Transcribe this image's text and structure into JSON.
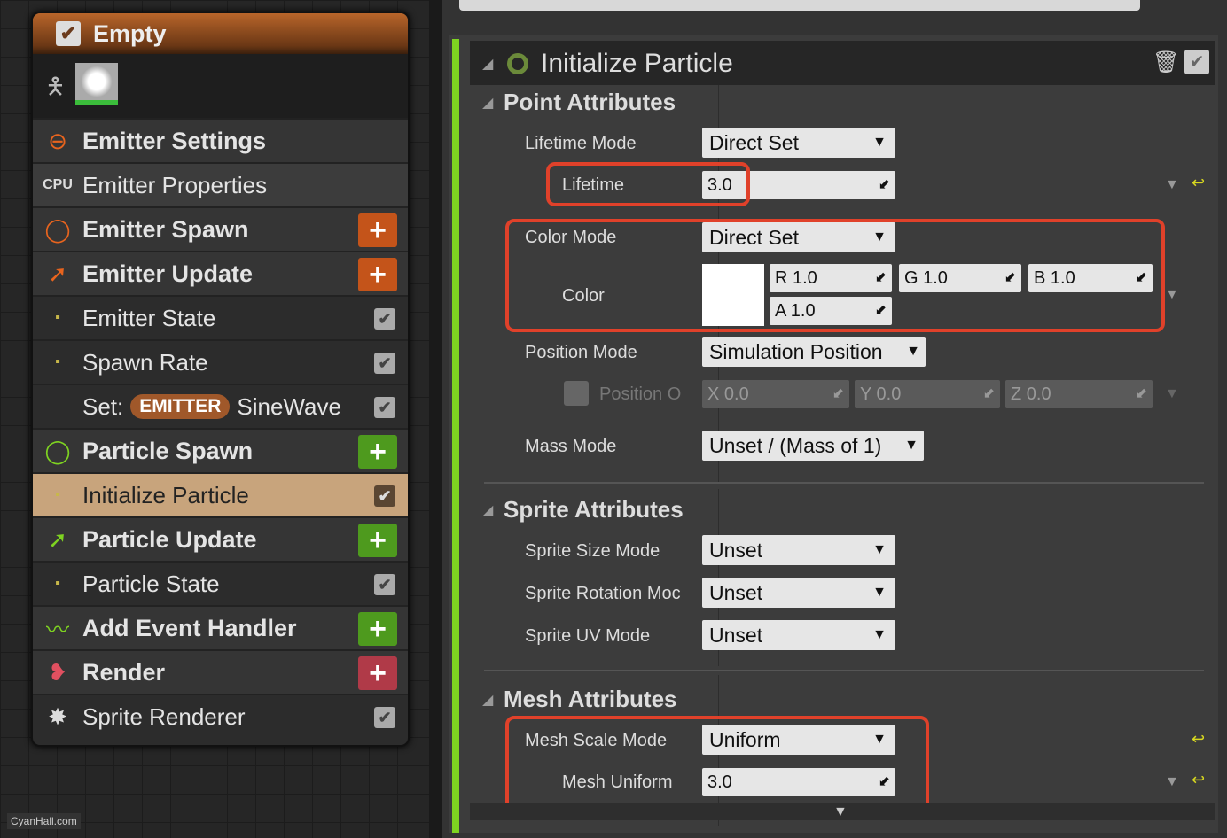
{
  "node": {
    "title": "Empty",
    "rows": [
      {
        "label": "Emitter Settings",
        "icon": "emitter-settings-icon",
        "type": "header"
      },
      {
        "label": "Emitter Properties",
        "icon": "cpu-icon",
        "type": "sub"
      },
      {
        "label": "Emitter Spawn",
        "icon": "ring-icon",
        "type": "header",
        "add": true,
        "color": "#c4541a"
      },
      {
        "label": "Emitter Update",
        "icon": "arrow-icon",
        "type": "header",
        "add": true,
        "color": "#c4541a"
      },
      {
        "label": "Emitter State",
        "icon": "module-icon",
        "type": "item",
        "checked": true
      },
      {
        "label": "Spawn Rate",
        "icon": "module-icon",
        "type": "item",
        "checked": true
      },
      {
        "label": "Set:",
        "pill": "EMITTER",
        "suffix": "SineWave",
        "type": "item",
        "checked": true
      },
      {
        "label": "Particle Spawn",
        "icon": "ring-icon",
        "type": "header",
        "add": true,
        "color": "#4e9a1e"
      },
      {
        "label": "Initialize Particle",
        "icon": "module-icon",
        "type": "selected",
        "checked": true
      },
      {
        "label": "Particle Update",
        "icon": "arrow-icon",
        "type": "header",
        "add": true,
        "color": "#4e9a1e"
      },
      {
        "label": "Particle State",
        "icon": "module-icon",
        "type": "item",
        "checked": true
      },
      {
        "label": "Add Event Handler",
        "icon": "event-icon",
        "type": "header",
        "add": true,
        "color": "#4e9a1e"
      },
      {
        "label": "Render",
        "icon": "render-icon",
        "type": "header",
        "add": true,
        "color": "#b03a48"
      },
      {
        "label": "Sprite Renderer",
        "icon": "sprite-icon",
        "type": "item",
        "checked": true
      }
    ]
  },
  "watermark": "CyanHall.com",
  "module": {
    "title": "Initialize Particle",
    "point": {
      "title": "Point Attributes",
      "lifetime_mode_label": "Lifetime Mode",
      "lifetime_mode": "Direct Set",
      "lifetime_label": "Lifetime",
      "lifetime": "3.0",
      "color_mode_label": "Color Mode",
      "color_mode": "Direct Set",
      "color_label": "Color",
      "color_hex": "#ffffff",
      "r": "R  1.0",
      "g": "G  1.0",
      "b": "B  1.0",
      "a": "A  1.0",
      "position_mode_label": "Position Mode",
      "position_mode": "Simulation Position",
      "position_offset_label": "Position O",
      "x": "X  0.0",
      "y": "Y  0.0",
      "z": "Z  0.0",
      "mass_mode_label": "Mass Mode",
      "mass_mode": "Unset / (Mass of 1)"
    },
    "sprite": {
      "title": "Sprite Attributes",
      "size_label": "Sprite Size Mode",
      "size": "Unset",
      "rotation_label": "Sprite Rotation Moc",
      "rotation": "Unset",
      "uv_label": "Sprite UV Mode",
      "uv": "Unset"
    },
    "mesh": {
      "title": "Mesh Attributes",
      "scale_mode_label": "Mesh Scale Mode",
      "scale_mode": "Uniform",
      "uniform_label": "Mesh Uniform",
      "uniform": "3.0"
    }
  }
}
